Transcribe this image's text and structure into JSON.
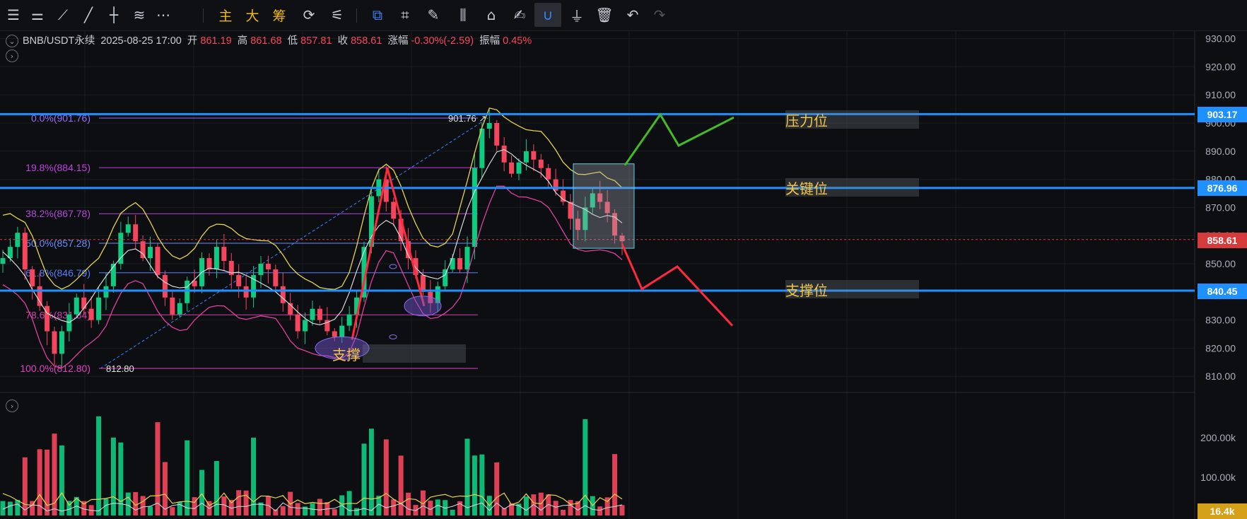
{
  "toolbar": {
    "icons": [
      "menu-icon",
      "indicator-settings-icon",
      "trend-line-icon",
      "ray-line-icon",
      "horizontal-line-icon",
      "fib-tool-icon",
      "more-icon"
    ],
    "text_buttons": [
      "主",
      "大",
      "筹"
    ],
    "icons2": [
      "compare-icon",
      "trade-tool-icon",
      "copy-icon",
      "ruler-icon",
      "brush-icon",
      "candle-type-icon",
      "lock-icon",
      "note-icon",
      "magnet-icon",
      "filter-icon",
      "delete-icon",
      "undo-icon",
      "redo-icon"
    ]
  },
  "info_bar": {
    "symbol": "BNB/USDT永续",
    "datetime": "2025-08-25 17:00",
    "open_label": "开",
    "open": "861.19",
    "high_label": "高",
    "high": "861.68",
    "low_label": "低",
    "low": "857.81",
    "close_label": "收",
    "close": "858.61",
    "change_label": "涨幅",
    "change": "-0.30%(-2.59)",
    "amplitude_label": "振幅",
    "amplitude": "0.45%"
  },
  "zones": {
    "resistance": {
      "label": "压力位",
      "price": "903.17"
    },
    "key": {
      "label": "关键位",
      "price": "876.96"
    },
    "support": {
      "label": "支撑位",
      "price": "840.45"
    },
    "support_note": "支撑"
  },
  "current_price_tag": "858.61",
  "volume_tag": "16.4k",
  "fib_annotation_high": "901.76",
  "fib_annotation_low": "812.80",
  "colors": {
    "resistance_line": "#1e90ff",
    "up": "#0ecb81",
    "down": "#f6465d",
    "label": "#f5c542",
    "fib": "#c040e0"
  },
  "chart_data": [
    {
      "type": "candlestick",
      "title": "BNB/USDT永续",
      "y_ticks": [
        "930.00",
        "920.00",
        "910.00",
        "900.00",
        "890.00",
        "880.00",
        "870.00",
        "860.00",
        "850.00",
        "840.00",
        "830.00",
        "820.00",
        "810.00"
      ],
      "ylim": [
        805,
        932
      ],
      "horizontal_levels": [
        903.17,
        876.96,
        840.45
      ],
      "last_price": 858.61,
      "fibonacci": [
        {
          "label": "0.0%(901.76)",
          "value": 901.76
        },
        {
          "label": "19.8%(884.15)",
          "value": 884.15
        },
        {
          "label": "38.2%(867.78)",
          "value": 867.78
        },
        {
          "label": "50.0%(857.28)",
          "value": 857.28
        },
        {
          "label": "61.8%(846.79)",
          "value": 846.79
        },
        {
          "label": "78.6%(831.84)",
          "value": 831.84
        },
        {
          "label": "100.0%(812.80)",
          "value": 812.8
        }
      ],
      "close_path": [
        852,
        856,
        861,
        848,
        842,
        835,
        826,
        818,
        826,
        832,
        838,
        834,
        830,
        838,
        842,
        850,
        861,
        864,
        858,
        852,
        856,
        846,
        838,
        832,
        836,
        844,
        842,
        852,
        848,
        856,
        851,
        846,
        842,
        838,
        846,
        850,
        848,
        842,
        836,
        832,
        826,
        830,
        834,
        830,
        826,
        824,
        828,
        832,
        838,
        856,
        874,
        880,
        872,
        866,
        858,
        852,
        846,
        840,
        836,
        842,
        848,
        852,
        848,
        856,
        884,
        898,
        900,
        892,
        886,
        882,
        886,
        890,
        887,
        884,
        880,
        876,
        872,
        866,
        862,
        870,
        875,
        872,
        868,
        860,
        858
      ],
      "bullish_path_prediction": [
        885,
        903,
        892,
        902
      ],
      "bearish_path_prediction": [
        857,
        841,
        849,
        828
      ]
    },
    {
      "type": "bar",
      "title": "volume",
      "y_ticks": [
        "200.00k",
        "100.00k"
      ],
      "last_volume": "16.4k"
    }
  ]
}
